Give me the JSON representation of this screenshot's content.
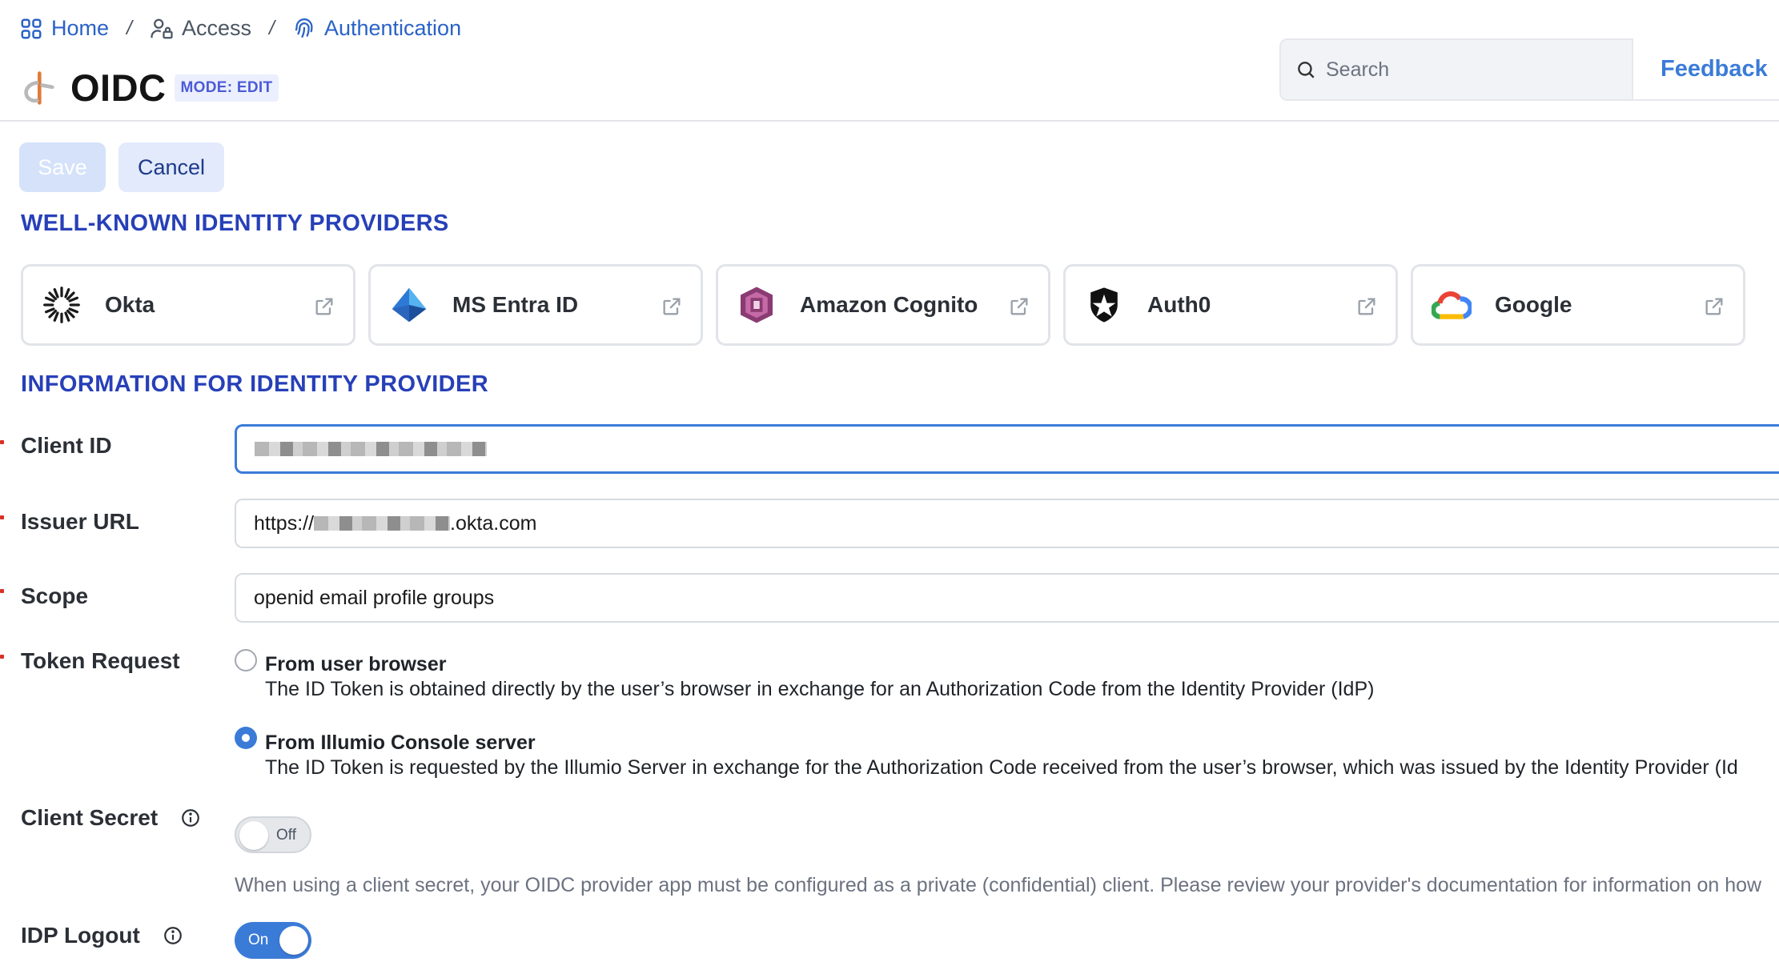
{
  "breadcrumb": {
    "home": "Home",
    "access": "Access",
    "authentication": "Authentication"
  },
  "header": {
    "title": "OIDC",
    "mode": "MODE: EDIT",
    "search_placeholder": "Search",
    "feedback": "Feedback"
  },
  "toolbar": {
    "save_label": "Save",
    "cancel_label": "Cancel"
  },
  "providers_section": {
    "title": "WELL-KNOWN IDENTITY PROVIDERS",
    "items": [
      {
        "name": "Okta",
        "icon": "okta-logo-icon"
      },
      {
        "name": "MS Entra ID",
        "icon": "ms-entra-logo-icon"
      },
      {
        "name": "Amazon Cognito",
        "icon": "amazon-cognito-logo-icon"
      },
      {
        "name": "Auth0",
        "icon": "auth0-logo-icon"
      },
      {
        "name": "Google",
        "icon": "google-cloud-logo-icon"
      }
    ]
  },
  "info_section": {
    "title": "INFORMATION FOR IDENTITY PROVIDER"
  },
  "form": {
    "client_id": {
      "label": "Client ID"
    },
    "issuer_url": {
      "label": "Issuer URL",
      "prefix": "https://",
      "suffix": ".okta.com"
    },
    "scope": {
      "label": "Scope",
      "value": "openid email profile groups"
    },
    "token_request": {
      "label": "Token Request",
      "options": [
        {
          "title": "From user browser",
          "description": "The ID Token is obtained directly by the user’s browser in exchange for an Authorization Code from the Identity Provider (IdP)",
          "selected": false
        },
        {
          "title": "From Illumio Console server",
          "description": "The ID Token is requested by the Illumio Server in exchange for the Authorization Code received from the user’s browser, which was issued by the Identity Provider (Id",
          "selected": true
        }
      ]
    },
    "client_secret": {
      "label": "Client Secret",
      "state": "Off",
      "hint": "When using a client secret, your OIDC provider app must be configured as a private (confidential) client. Please review your provider's documentation for information on how"
    },
    "idp_logout": {
      "label": "IDP Logout",
      "state": "On"
    }
  },
  "colors": {
    "accent": "#3b7bd8",
    "section_title": "#2740b8",
    "link": "#2a62c6",
    "required": "#d93025"
  }
}
